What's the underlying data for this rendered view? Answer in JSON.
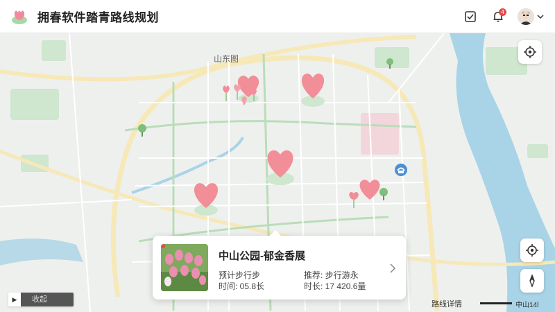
{
  "app": {
    "title": "拥春软件踏青路线规划"
  },
  "header": {
    "notification_count": "4",
    "icons": [
      "checklist-icon",
      "bell-icon",
      "avatar",
      "chevron-down-icon"
    ]
  },
  "map": {
    "district_label": "山东图"
  },
  "card": {
    "title": "中山公园-郁金香展",
    "estimate_label": "预计步行步",
    "time_label": "时间: 05.8长",
    "recommend_label": "推荐: 步行游永",
    "duration_label": "时长: 17 420.6量"
  },
  "controls": {
    "collapse_label": "收起",
    "scale_label": "路线详情",
    "scale_value": "中山14l"
  },
  "colors": {
    "heart": "#f18e97",
    "park": "#cfe6cf",
    "water": "#a9d3e6",
    "road_major": "#f7e8b8",
    "road_green": "#b9ddb9"
  }
}
